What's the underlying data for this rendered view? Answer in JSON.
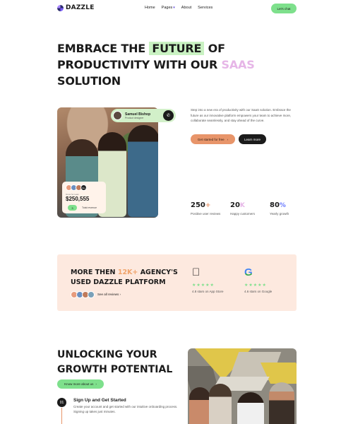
{
  "nav": {
    "brand": "DAZZLE",
    "links": [
      "Home",
      "Pages",
      "About",
      "Services"
    ],
    "cta": "Let's chat"
  },
  "hero": {
    "line1_a": "EMBRACE THE",
    "line1_highlight": "FUTURE",
    "line1_b": "OF",
    "line2_a": "PRODUCTIVITY WITH OUR",
    "line2_highlight": "SAAS",
    "line3": "SOLUTION"
  },
  "user_chip": {
    "name": "Samuel Bishop",
    "role": "Product designer"
  },
  "revenue_card": {
    "avatar_more": "12+",
    "label": "Grow for team",
    "value": "$250,555",
    "pill": "3",
    "sub": "Total revenue"
  },
  "intro": {
    "text": "Step into a new era of productivity with our SaaS solution. Embrace the future as our innovative platform empowers your team to achieve more, collaborate seamlessly, and stay ahead of the curve.",
    "primary_button": "Get started for free",
    "secondary_button": "Learn more"
  },
  "stats": [
    {
      "value": "250",
      "suffix": "+",
      "suffix_color": "#e8956a",
      "label": "Positive user reviews"
    },
    {
      "value": "20",
      "suffix": "K",
      "suffix_color": "#e6b6e7",
      "label": "Happy customers"
    },
    {
      "value": "80",
      "suffix": "%",
      "suffix_color": "#6b7cff",
      "label": "Yearly growth"
    }
  ],
  "platform": {
    "title_a": "MORE THEN",
    "title_highlight": "12K+",
    "title_b": "AGENCY'S",
    "title_line2": "USED DAZZLE PLATFORM",
    "link": "See all reviews",
    "stores": [
      {
        "icon": "apple-icon",
        "stars": "★★★★★",
        "label": "4.8 stars on App Store"
      },
      {
        "icon": "google-icon",
        "stars": "★★★★★",
        "label": "4.6 stars on Google"
      }
    ]
  },
  "growth": {
    "title_line1": "UNLOCKING YOUR",
    "title_line2": "GROWTH POTENTIAL",
    "button": "Know more about us",
    "step": {
      "number": "01",
      "title": "Sign Up and Get Started",
      "desc": "Create your account and get started with our intuitive onboarding process. Signing up takes just minutes."
    }
  },
  "colors": {
    "accent_green": "#7ee08c",
    "accent_orange": "#e8956a",
    "accent_pink": "#e6b6e7",
    "band_bg": "#fde9df"
  }
}
